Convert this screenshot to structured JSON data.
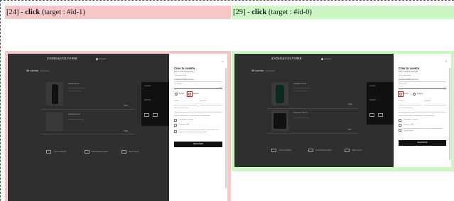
{
  "steps": [
    {
      "index": "[24]",
      "action": "click",
      "target": "(target : #id-1)"
    },
    {
      "index": "[29]",
      "action": "click",
      "target": "(target : #id-0)"
    }
  ],
  "colors": {
    "left_caption_bg": "#f7c7c7",
    "right_caption_bg": "#cdf6c5",
    "highlight": "#e01010",
    "overlay": "#2f2f2f"
  },
  "shop": {
    "logo": "ZADIG&VOLTAIRE",
    "cart_title": "MI carrito",
    "cart_count": "(2 artículos)",
    "country": "España"
  },
  "left_shot": {
    "products": [
      {
        "name": "Vestido Rose",
        "price": "€345"
      },
      {
        "name": "Sudadera Aran",
        "price": "€195"
      }
    ],
    "summary": {
      "label": "Subtotal",
      "button": "PEDIDO"
    },
    "footer": [
      "Envío estándar",
      "Devoluciones gratis",
      "Pago seguro"
    ],
    "modal": {
      "title": "Crea tu cuenta",
      "subtitle": "Con tu cuenta personal",
      "email_label": "Correo electrónico",
      "email_value": "prueba.email@mail.com",
      "password_label": "Contraseña",
      "gender_options": [
        "Señor",
        "Señora"
      ],
      "first_name": "Nombre",
      "last_name": "Apellido",
      "birth_date": "Fecha de nacimiento",
      "consent_text": "Deseo recibir ofertas y novedades de Zadig&Voltaire",
      "checkboxes": [
        "Novedades y ofertas",
        "Mensajes SMS"
      ],
      "legal_text": "Al crear mi cuenta acepto los términos y condiciones y la política de privacidad de Zadig&Voltaire",
      "submit": "REGISTRAR"
    }
  },
  "right_shot": {
    "products": [
      {
        "name": "Cárdigan Verde",
        "price": "€298"
      },
      {
        "name": "Camiseta Tommy",
        "price": "€85"
      }
    ],
    "summary": {
      "label": "Subtotal",
      "button": "PEDIDO"
    },
    "footer": [
      "Envío estándar",
      "Devoluciones gratis",
      "Pago seguro"
    ],
    "modal": {
      "title": "Crea tu cuenta",
      "subtitle": "Con tu cuenta personal",
      "email_label": "Correo electrónico",
      "email_value": "prueba.email@mail.com",
      "password_label": "Contraseña",
      "gender_options": [
        "Señor",
        "Señora"
      ],
      "first_name": "Nombre",
      "last_name": "Apellido",
      "birth_date": "Fecha de nacimiento",
      "consent_text": "Deseo recibir ofertas y novedades de Zadig&Voltaire",
      "checkboxes": [
        "Novedades y ofertas",
        "Mensajes SMS"
      ],
      "legal_text": "Al crear mi cuenta acepto los términos y condiciones de Zadig&Voltaire",
      "submit": "REGISTRAR"
    }
  }
}
